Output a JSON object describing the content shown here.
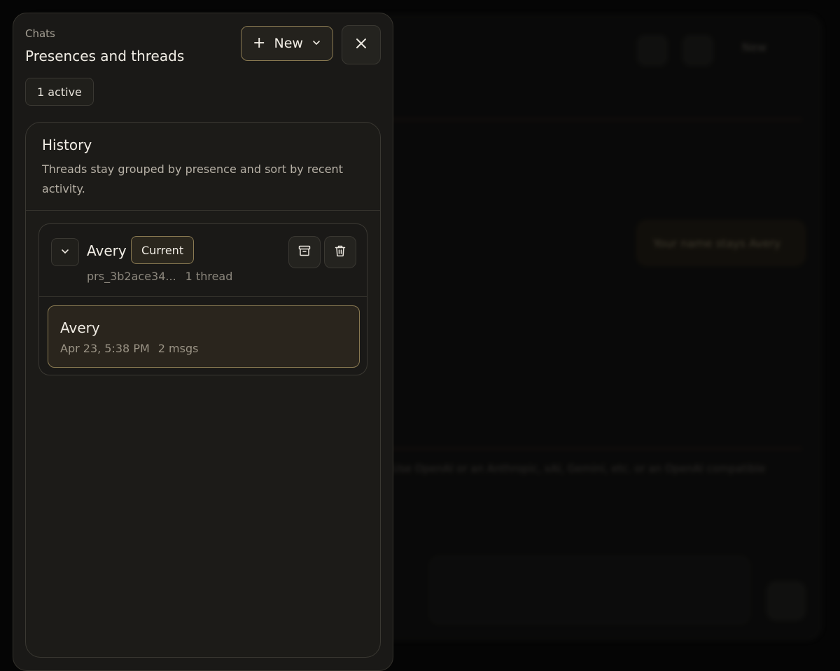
{
  "drawer": {
    "eyebrow": "Chats",
    "title": "Presences and threads",
    "new_button": {
      "plus": "+",
      "label": "New"
    },
    "close_icon": "close-icon",
    "active_badge": "1 active"
  },
  "history": {
    "title": "History",
    "description": "Threads stay grouped by presence and sort by recent activity.",
    "presences": [
      {
        "name": "Avery",
        "badge": "Current",
        "id": "prs_3b2ace34...",
        "thread_count": "1 thread",
        "threads": [
          {
            "name": "Avery",
            "date": "Apr 23, 5:38 PM",
            "msgs": "2 msgs"
          }
        ]
      }
    ]
  },
  "background": {
    "bubble_text": "Your name stays Avery",
    "hint_text": "Use OpenAI or an Anthropic, xAI, Gemini, etc. or an OpenAI compatible",
    "new_label": "New"
  },
  "colors": {
    "accent_border": "#8a7a52",
    "panel": "#1a1917",
    "text": "#f1ede5"
  }
}
